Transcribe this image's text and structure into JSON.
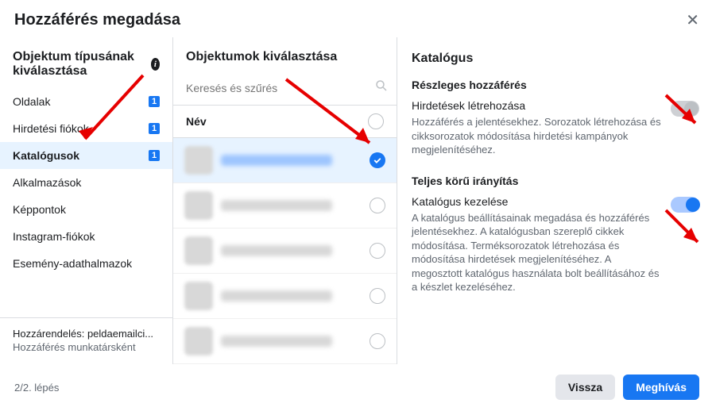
{
  "header": {
    "title": "Hozzáférés megadása"
  },
  "col1": {
    "title": "Objektum típusának kiválasztása",
    "items": [
      {
        "label": "Oldalak",
        "badge": "1"
      },
      {
        "label": "Hirdetési fiókok",
        "badge": "1"
      },
      {
        "label": "Katalógusok",
        "badge": "1"
      },
      {
        "label": "Alkalmazások",
        "badge": ""
      },
      {
        "label": "Képpontok",
        "badge": ""
      },
      {
        "label": "Instagram-fiókok",
        "badge": ""
      },
      {
        "label": "Esemény-adathalmazok",
        "badge": ""
      }
    ],
    "assign": {
      "line1": "Hozzárendelés: peldaemailci...",
      "line2": "Hozzáférés munkatársként"
    }
  },
  "col2": {
    "title": "Objektumok kiválasztása",
    "search_placeholder": "Keresés és szűrés",
    "name_header": "Név"
  },
  "col3": {
    "title": "Katalógus",
    "partial_header": "Részleges hozzáférés",
    "perm1": {
      "title": "Hirdetések létrehozása",
      "desc": "Hozzáférés a jelentésekhez. Sorozatok létrehozása és cikksorozatok módosítása hirdetési kampányok megjelenítéséhez."
    },
    "full_header": "Teljes körű irányítás",
    "perm2": {
      "title": "Katalógus kezelése",
      "desc": "A katalógus beállításainak megadása és hozzáférés jelentésekhez. A katalógusban szereplő cikkek módosítása. Terméksorozatok létrehozása és módosítása hirdetések megjelenítéséhez. A megosztott katalógus használata bolt beállításához és a készlet kezeléséhez."
    }
  },
  "footer": {
    "step": "2/2. lépés",
    "back": "Vissza",
    "invite": "Meghívás"
  }
}
